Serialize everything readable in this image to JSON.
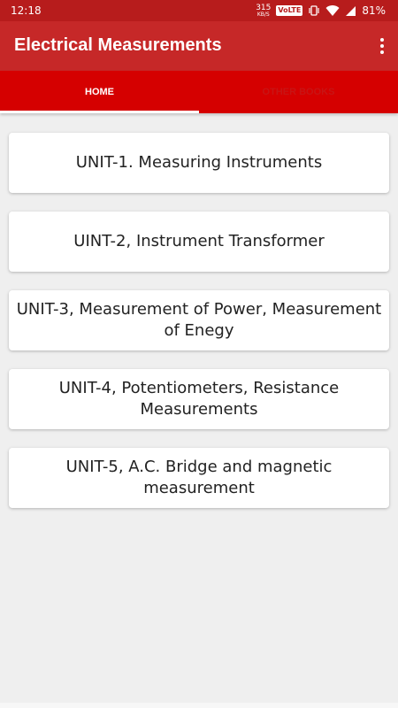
{
  "status_bar": {
    "time": "12:18",
    "speed_value": "315",
    "speed_unit": "KB/S",
    "volte": "VoLTE",
    "battery": "81%"
  },
  "app_bar": {
    "title": "Electrical Measurements",
    "menu_icon": "more-vert-icon"
  },
  "tabs": [
    {
      "label": "HOME",
      "selected": true
    },
    {
      "label": "OTHER BOOKS",
      "selected": false
    }
  ],
  "units": [
    {
      "label": "UNIT-1. Measuring Instruments"
    },
    {
      "label": "UINT-2, Instrument Transformer"
    },
    {
      "label": "UNIT-3, Measurement of Power, Measurement of Enegy"
    },
    {
      "label": "UNIT-4, Potentiometers, Resistance Measurements"
    },
    {
      "label": "UNIT-5,  A.C. Bridge and magnetic measurement"
    }
  ],
  "colors": {
    "status_bar": "#b71c1c",
    "app_bar": "#c62828",
    "tab_bar": "#d50000",
    "background": "#efefef"
  }
}
